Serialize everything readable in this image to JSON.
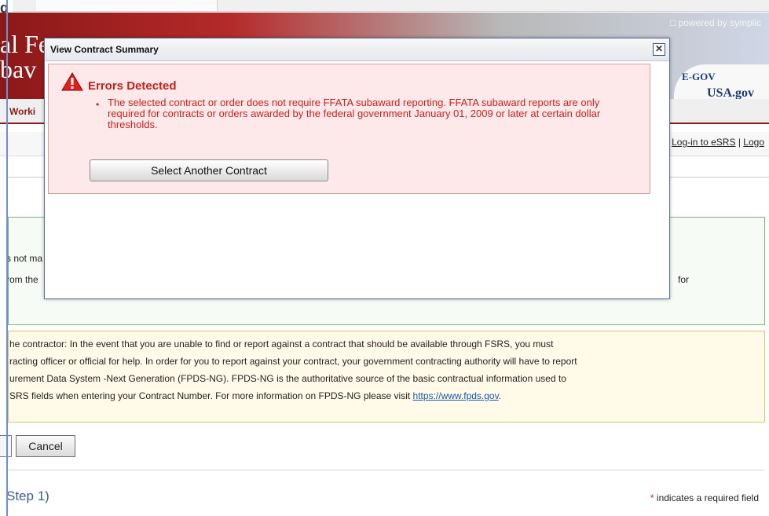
{
  "page": {
    "top_snippet": "g",
    "header_title_line1": "al Fe",
    "header_title_line2": "bav",
    "powered_by": "□ powered by symplic",
    "egov_text": "E-GOV",
    "usagov_text": "USA.gov",
    "nav_working": "Worki",
    "login_links": {
      "login": "Log-in to eSRS",
      "separator": "|",
      "logout": "Logo"
    },
    "green_box": {
      "line1": "s not ma",
      "line2": "rom the",
      "tail_for": "for"
    },
    "notice_lines": [
      "he contractor: In the event that you are unable to find or report against a contract that should be available through FSRS, you must",
      "racting officer or official for help. In order for you to report against your contract, your government contracting authority will have to report",
      "urement Data System -Next Generation (FPDS-NG). FPDS-NG is the authoritative source of the basic contractual information used to",
      "SRS fields when entering your Contract Number. For more information on FPDS-NG please visit "
    ],
    "notice_link": "https://www.fpds.gov",
    "notice_link_tail": ".",
    "cancel_label": "Cancel",
    "step_label": "Step 1)",
    "required_note": {
      "star": "*",
      "text": " indicates a required field"
    }
  },
  "modal": {
    "title": "View Contract Summary",
    "close_glyph": "✕",
    "error_heading": "Errors Detected",
    "bullet_glyph": "•",
    "error_message": "The selected contract or order does not require FFATA subaward reporting. FFATA subaward reports are only required for contracts or orders awarded by the federal government January 01, 2009 or later at certain dollar thresholds.",
    "select_button_label": "Select Another Contract"
  },
  "icons": {
    "warning": "warning-triangle-icon",
    "close": "close-icon"
  },
  "colors": {
    "error_text": "#c21f1f",
    "error_bg": "#fde9e9",
    "header_red": "#8c1818",
    "link_blue": "#1a56a8"
  }
}
